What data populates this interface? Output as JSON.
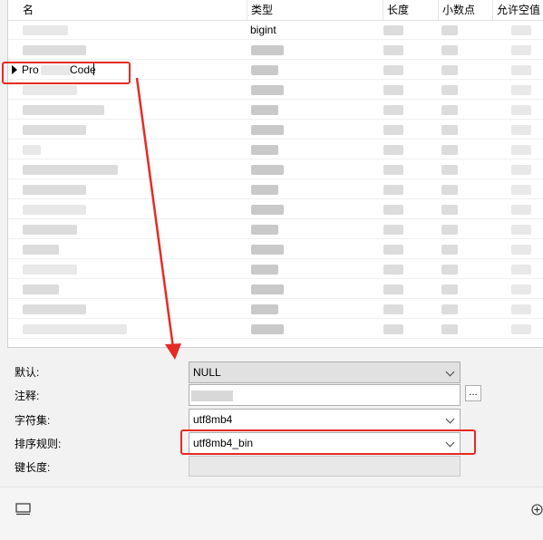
{
  "grid": {
    "columns": [
      {
        "label": "名"
      },
      {
        "label": "类型"
      },
      {
        "label": "长度"
      },
      {
        "label": "小数点"
      },
      {
        "label": "允许空值"
      }
    ],
    "first_row_type": "bigint",
    "selected_row_name_start": "Pro",
    "selected_row_name_end": "Code"
  },
  "properties": {
    "default_label": "默认:",
    "default_value": "NULL",
    "comment_label": "注释:",
    "comment_button": "...",
    "charset_label": "字符集:",
    "charset_value": "utf8mb4",
    "collation_label": "排序规则:",
    "collation_value": "utf8mb4_bin",
    "key_length_label": "键长度:"
  },
  "colors": {
    "annotation": "#e52b24"
  },
  "icons": {
    "bottom_left": "panel-layout-icon",
    "bottom_right": "add-circle-icon"
  }
}
